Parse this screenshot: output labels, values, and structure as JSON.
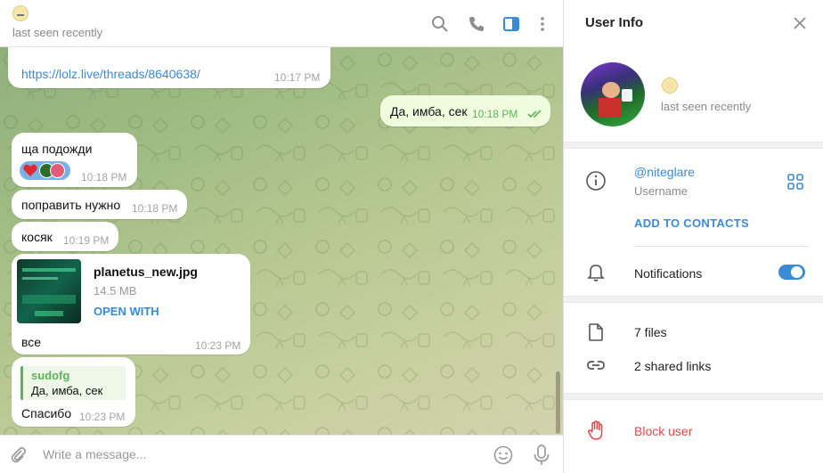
{
  "header": {
    "status": "last seen recently",
    "icons": [
      "search-icon",
      "phone-icon",
      "sidebar-toggle-icon",
      "more-vertical-icon"
    ]
  },
  "messages": {
    "m1": {
      "link": "https://lolz.live/threads/8640638/",
      "time": "10:17 PM"
    },
    "m2": {
      "text": "Да, имба, сек",
      "time": "10:18 PM"
    },
    "m3": {
      "text": "ща подожди",
      "time": "10:18 PM"
    },
    "m4": {
      "text": "поправить нужно",
      "time": "10:18 PM"
    },
    "m5": {
      "text": "косяк",
      "time": "10:19 PM"
    },
    "m6": {
      "file_name": "planetus_new.jpg",
      "file_size": "14.5 MB",
      "action": "OPEN WITH",
      "caption": "все",
      "time": "10:23 PM"
    },
    "m7": {
      "reply_author": "sudofg",
      "reply_text": "Да, имба, сек",
      "text": "Спасибо",
      "time": "10:23 PM"
    }
  },
  "composer": {
    "placeholder": "Write a message..."
  },
  "info": {
    "title": "User Info",
    "status": "last seen recently",
    "username": "@niteglare",
    "username_label": "Username",
    "add_contact": "ADD TO CONTACTS",
    "notifications": "Notifications",
    "notifications_on": true,
    "files": "7 files",
    "links": "2 shared links",
    "block": "Block user"
  },
  "colors": {
    "accent": "#3a8bd6",
    "danger": "#e0464c",
    "outgoing": "#effdde",
    "check": "#5fb25c"
  }
}
